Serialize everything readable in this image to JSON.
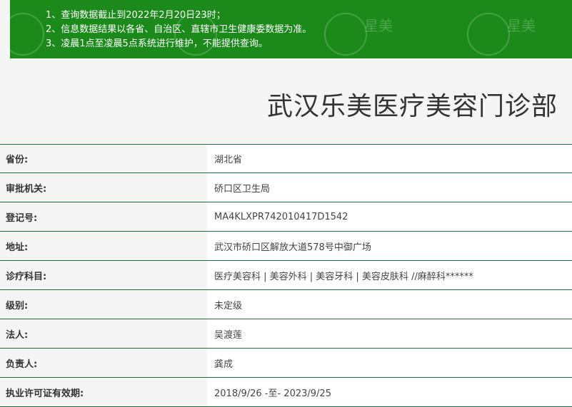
{
  "notice": {
    "lines": [
      "1、查询数据截止到2022年2月20日23时；",
      "2、信息数据结果以各省、自治区、直辖市卫生健康委数据为准。",
      "3、凌晨1点至凌晨5点系统进行维护，不能提供查询。"
    ],
    "watermark": "星美"
  },
  "page_title": "武汉乐美医疗美容门诊部",
  "rows": [
    {
      "label": "省份:",
      "value": "湖北省"
    },
    {
      "label": "审批机关:",
      "value": "硚口区卫生局"
    },
    {
      "label": "登记号:",
      "value": "MA4KLXPR742010417D1542"
    },
    {
      "label": "地址:",
      "value": "武汉市硚口区解放大道578号中御广场"
    },
    {
      "label": "诊疗科目:",
      "value": "医疗美容科 | 美容外科 | 美容牙科 | 美容皮肤科 //麻醉科******"
    },
    {
      "label": "级别:",
      "value": "未定级"
    },
    {
      "label": "法人:",
      "value": "吴渡莲"
    },
    {
      "label": "负责人:",
      "value": "龚成"
    },
    {
      "label": "执业许可证有效期:",
      "value": "2018/9/26 -至- 2023/9/25"
    }
  ]
}
